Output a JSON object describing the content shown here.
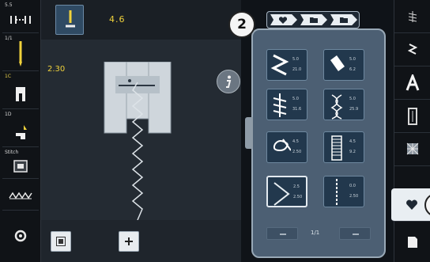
{
  "left_sidebar": {
    "stitch_width_value": "5.5",
    "needle_position_label": "1/1",
    "presser_foot_code": "1C",
    "foot_pressure_label": "1D",
    "stitch_length_label": "Stitch"
  },
  "stitch_settings": {
    "width_display": "4.6",
    "length_display": "2.30"
  },
  "panel": {
    "callout_number": "2",
    "page_indicator": "1/1",
    "stitches": [
      {
        "id": "1",
        "line1": "5.0",
        "line2": "21.0"
      },
      {
        "id": "2",
        "line1": "5.0",
        "line2": "6.2"
      },
      {
        "id": "3",
        "line1": "5.0",
        "line2": "31.6"
      },
      {
        "id": "4",
        "line1": "5.0",
        "line2": "25.9"
      },
      {
        "id": "5",
        "line1": "4.5",
        "line2": "2.50"
      },
      {
        "id": "6",
        "line1": "4.5",
        "line2": "9.2"
      },
      {
        "id": "7",
        "line1": "2.5",
        "line2": "2.50"
      },
      {
        "id": "8",
        "line1": "0.0",
        "line2": "2.50"
      }
    ]
  },
  "right_sidebar": {
    "active_item": "personal-program"
  },
  "colors": {
    "accent_yellow": "#f0d23b",
    "panel_blue": "#4c5f73",
    "cell_blue": "#22384d"
  }
}
